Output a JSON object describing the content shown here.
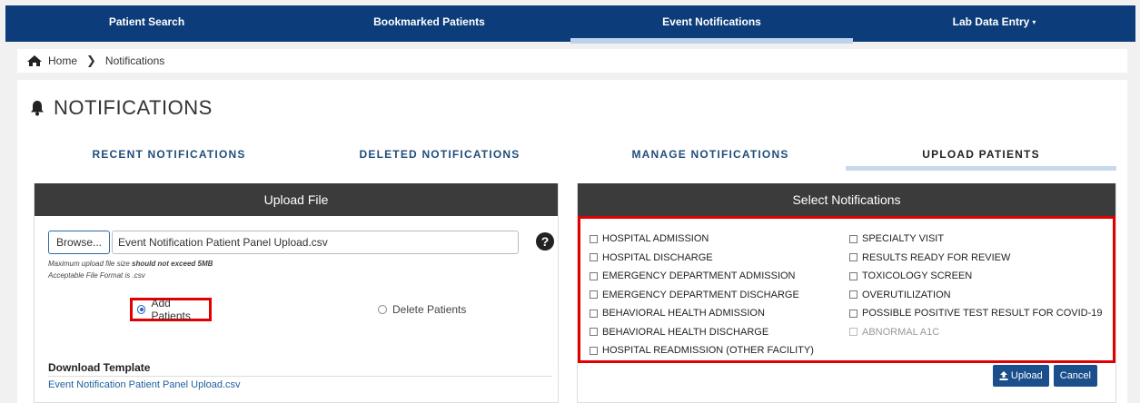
{
  "topnav": [
    {
      "label": "Patient Search",
      "active": false
    },
    {
      "label": "Bookmarked Patients",
      "active": false
    },
    {
      "label": "Event Notifications",
      "active": true
    },
    {
      "label": "Lab Data Entry",
      "active": false,
      "dropdown": true
    }
  ],
  "breadcrumb": {
    "home": "Home",
    "current": "Notifications"
  },
  "page_title": "NOTIFICATIONS",
  "tabs": [
    {
      "label": "RECENT NOTIFICATIONS",
      "active": false
    },
    {
      "label": "DELETED NOTIFICATIONS",
      "active": false
    },
    {
      "label": "MANAGE NOTIFICATIONS",
      "active": false
    },
    {
      "label": "UPLOAD PATIENTS",
      "active": true
    }
  ],
  "upload": {
    "header": "Upload File",
    "browse_label": "Browse...",
    "file_value": "Event Notification Patient Panel Upload.csv",
    "help_glyph": "?",
    "hint_size_prefix": "Maximum upload file size ",
    "hint_size_bold": "should not exceed 5MB",
    "hint_format": "Acceptable File Format is .csv",
    "add_patients": "Add Patients",
    "delete_patients": "Delete Patients",
    "download_title": "Download Template",
    "download_link": "Event Notification Patient Panel Upload.csv"
  },
  "notifications": {
    "header": "Select Notifications",
    "col1": [
      "HOSPITAL ADMISSION",
      "HOSPITAL DISCHARGE",
      "EMERGENCY DEPARTMENT ADMISSION",
      "EMERGENCY DEPARTMENT DISCHARGE",
      "BEHAVIORAL HEALTH ADMISSION",
      "BEHAVIORAL HEALTH DISCHARGE",
      "HOSPITAL READMISSION (OTHER FACILITY)"
    ],
    "col2": [
      "SPECIALTY VISIT",
      "RESULTS READY FOR REVIEW",
      "TOXICOLOGY SCREEN",
      "OVERUTILIZATION",
      "POSSIBLE POSITIVE TEST RESULT FOR COVID-19",
      "ABNORMAL A1C"
    ],
    "upload_btn": "Upload",
    "cancel_btn": "Cancel"
  },
  "colors": {
    "nav": "#0c3d7a",
    "highlight": "#e00000",
    "button": "#1a4f8c"
  }
}
